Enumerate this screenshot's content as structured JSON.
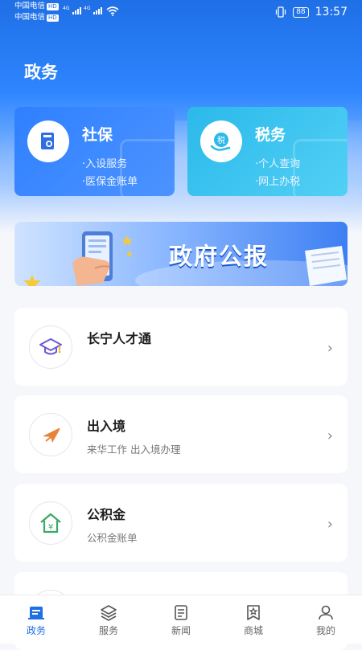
{
  "status_bar": {
    "carrier1": "中国电信",
    "carrier2": "中国电信",
    "hd": "HD",
    "net1": "4G",
    "net2": "4G",
    "battery": "88",
    "time": "13:57"
  },
  "header": {
    "title": "政务"
  },
  "tiles": [
    {
      "name": "社保",
      "items": [
        "·入设服务",
        "·医保金账单"
      ],
      "icon": "document-icon"
    },
    {
      "name": "税务",
      "items": [
        "·个人查询",
        "·网上办税"
      ],
      "icon": "tax-icon"
    }
  ],
  "banner": {
    "text": "政府公报"
  },
  "list": [
    {
      "title": "长宁人才通",
      "subtitle": "",
      "icon": "graduation-cap-icon"
    },
    {
      "title": "出入境",
      "subtitle": "来华工作 出入境办理",
      "icon": "airplane-icon"
    },
    {
      "title": "公积金",
      "subtitle": "公积金账单",
      "icon": "house-yuan-icon"
    },
    {
      "title": "",
      "subtitle": "",
      "icon": ""
    }
  ],
  "tabbar": [
    {
      "label": "政务",
      "active": true
    },
    {
      "label": "服务",
      "active": false
    },
    {
      "label": "新闻",
      "active": false
    },
    {
      "label": "商城",
      "active": false
    },
    {
      "label": "我的",
      "active": false
    }
  ],
  "colors": {
    "primary": "#1f6fe6",
    "shebao": "#2f80ff",
    "shuiwu": "#2bb9ea"
  }
}
